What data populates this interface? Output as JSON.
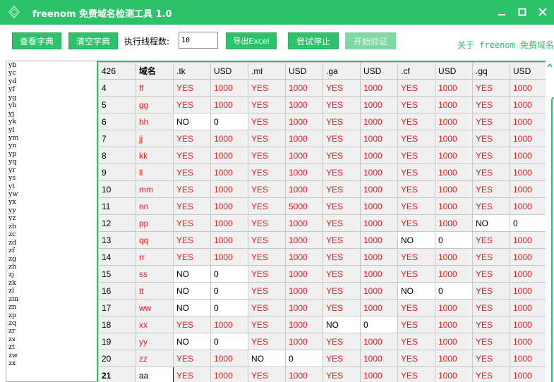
{
  "window": {
    "title": "freenom 免费域名检测工具 1.0",
    "accent_color": "#2bc26a",
    "icons": [
      "app-logo-icon",
      "minimize-icon",
      "maximize-icon",
      "close-icon"
    ]
  },
  "toolbar": {
    "view_dict_label": "查看字典",
    "clear_dict_label": "清空字典",
    "threads_label": "执行线程数:",
    "threads_value": "10",
    "export_label": "导出Excel",
    "stop_label": "尝试停止",
    "start_label": "开始验证",
    "about_label": "关于 freenom 免费域名"
  },
  "dictionary": [
    "yb",
    "yc",
    "yd",
    "yf",
    "yg",
    "yh",
    "yj",
    "yk",
    "yl",
    "ym",
    "yn",
    "yp",
    "yq",
    "yr",
    "ys",
    "yt",
    "yw",
    "yx",
    "yy",
    "yz",
    "zb",
    "zc",
    "zd",
    "zf",
    "zg",
    "zh",
    "zj",
    "zk",
    "zl",
    "zm",
    "zn",
    "zp",
    "zq",
    "zr",
    "zs",
    "zt",
    "zw",
    "zx"
  ],
  "grid": {
    "headers": [
      "426",
      "域名",
      ".tk",
      "USD",
      ".ml",
      "USD",
      ".ga",
      "USD",
      ".cf",
      "USD",
      ".gq",
      "USD"
    ],
    "rows": [
      {
        "num": "4",
        "name": "ff",
        "tk": [
          "YES",
          "1000"
        ],
        "ml": [
          "YES",
          "1000"
        ],
        "ga": [
          "YES",
          "1000"
        ],
        "cf": [
          "YES",
          "1000"
        ],
        "gq": [
          "YES",
          "1000"
        ]
      },
      {
        "num": "5",
        "name": "gg",
        "tk": [
          "YES",
          "1000"
        ],
        "ml": [
          "YES",
          "1000"
        ],
        "ga": [
          "YES",
          "1000"
        ],
        "cf": [
          "YES",
          "1000"
        ],
        "gq": [
          "YES",
          "1000"
        ]
      },
      {
        "num": "6",
        "name": "hh",
        "tk": [
          "NO",
          "0"
        ],
        "ml": [
          "YES",
          "1000"
        ],
        "ga": [
          "YES",
          "1000"
        ],
        "cf": [
          "YES",
          "1000"
        ],
        "gq": [
          "YES",
          "1000"
        ]
      },
      {
        "num": "7",
        "name": "jj",
        "tk": [
          "YES",
          "1000"
        ],
        "ml": [
          "YES",
          "1000"
        ],
        "ga": [
          "YES",
          "1000"
        ],
        "cf": [
          "YES",
          "1000"
        ],
        "gq": [
          "YES",
          "1000"
        ]
      },
      {
        "num": "8",
        "name": "kk",
        "tk": [
          "YES",
          "1000"
        ],
        "ml": [
          "YES",
          "1000"
        ],
        "ga": [
          "YES",
          "1000"
        ],
        "cf": [
          "YES",
          "1000"
        ],
        "gq": [
          "YES",
          "1000"
        ]
      },
      {
        "num": "9",
        "name": "ll",
        "tk": [
          "YES",
          "1000"
        ],
        "ml": [
          "YES",
          "1000"
        ],
        "ga": [
          "YES",
          "1000"
        ],
        "cf": [
          "YES",
          "1000"
        ],
        "gq": [
          "YES",
          "1000"
        ]
      },
      {
        "num": "10",
        "name": "mm",
        "tk": [
          "YES",
          "1000"
        ],
        "ml": [
          "YES",
          "1000"
        ],
        "ga": [
          "YES",
          "1000"
        ],
        "cf": [
          "YES",
          "1000"
        ],
        "gq": [
          "YES",
          "1000"
        ]
      },
      {
        "num": "11",
        "name": "nn",
        "tk": [
          "YES",
          "1000"
        ],
        "ml": [
          "YES",
          "5000"
        ],
        "ga": [
          "YES",
          "1000"
        ],
        "cf": [
          "YES",
          "1000"
        ],
        "gq": [
          "YES",
          "1000"
        ]
      },
      {
        "num": "12",
        "name": "pp",
        "tk": [
          "YES",
          "1000"
        ],
        "ml": [
          "YES",
          "1000"
        ],
        "ga": [
          "YES",
          "1000"
        ],
        "cf": [
          "YES",
          "1000"
        ],
        "gq": [
          "NO",
          "0"
        ]
      },
      {
        "num": "13",
        "name": "qq",
        "tk": [
          "YES",
          "1000"
        ],
        "ml": [
          "YES",
          "1000"
        ],
        "ga": [
          "YES",
          "1000"
        ],
        "cf": [
          "NO",
          "0"
        ],
        "gq": [
          "YES",
          "1000"
        ]
      },
      {
        "num": "14",
        "name": "rr",
        "tk": [
          "YES",
          "1000"
        ],
        "ml": [
          "YES",
          "1000"
        ],
        "ga": [
          "YES",
          "1000"
        ],
        "cf": [
          "YES",
          "1000"
        ],
        "gq": [
          "YES",
          "1000"
        ]
      },
      {
        "num": "15",
        "name": "ss",
        "tk": [
          "NO",
          "0"
        ],
        "ml": [
          "YES",
          "1000"
        ],
        "ga": [
          "YES",
          "1000"
        ],
        "cf": [
          "YES",
          "1000"
        ],
        "gq": [
          "YES",
          "1000"
        ]
      },
      {
        "num": "16",
        "name": "tt",
        "tk": [
          "NO",
          "0"
        ],
        "ml": [
          "YES",
          "1000"
        ],
        "ga": [
          "YES",
          "1000"
        ],
        "cf": [
          "NO",
          "0"
        ],
        "gq": [
          "YES",
          "1000"
        ]
      },
      {
        "num": "17",
        "name": "ww",
        "tk": [
          "NO",
          "0"
        ],
        "ml": [
          "YES",
          "1000"
        ],
        "ga": [
          "YES",
          "1000"
        ],
        "cf": [
          "YES",
          "1000"
        ],
        "gq": [
          "YES",
          "1000"
        ]
      },
      {
        "num": "18",
        "name": "xx",
        "tk": [
          "YES",
          "1000"
        ],
        "ml": [
          "YES",
          "1000"
        ],
        "ga": [
          "NO",
          "0"
        ],
        "cf": [
          "YES",
          "1000"
        ],
        "gq": [
          "YES",
          "1000"
        ]
      },
      {
        "num": "19",
        "name": "yy",
        "tk": [
          "NO",
          "0"
        ],
        "ml": [
          "YES",
          "1000"
        ],
        "ga": [
          "YES",
          "1000"
        ],
        "cf": [
          "YES",
          "1000"
        ],
        "gq": [
          "YES",
          "1000"
        ]
      },
      {
        "num": "20",
        "name": "zz",
        "tk": [
          "YES",
          "1000"
        ],
        "ml": [
          "NO",
          "0"
        ],
        "ga": [
          "YES",
          "1000"
        ],
        "cf": [
          "YES",
          "1000"
        ],
        "gq": [
          "YES",
          "1000"
        ]
      },
      {
        "num": "21",
        "name": "aa",
        "current": true,
        "tk": [
          "YES",
          "1000"
        ],
        "ml": [
          "YES",
          "1000"
        ],
        "ga": [
          "YES",
          "1000"
        ],
        "cf": [
          "YES",
          "1000"
        ],
        "gq": [
          "YES",
          "1000"
        ]
      }
    ]
  }
}
